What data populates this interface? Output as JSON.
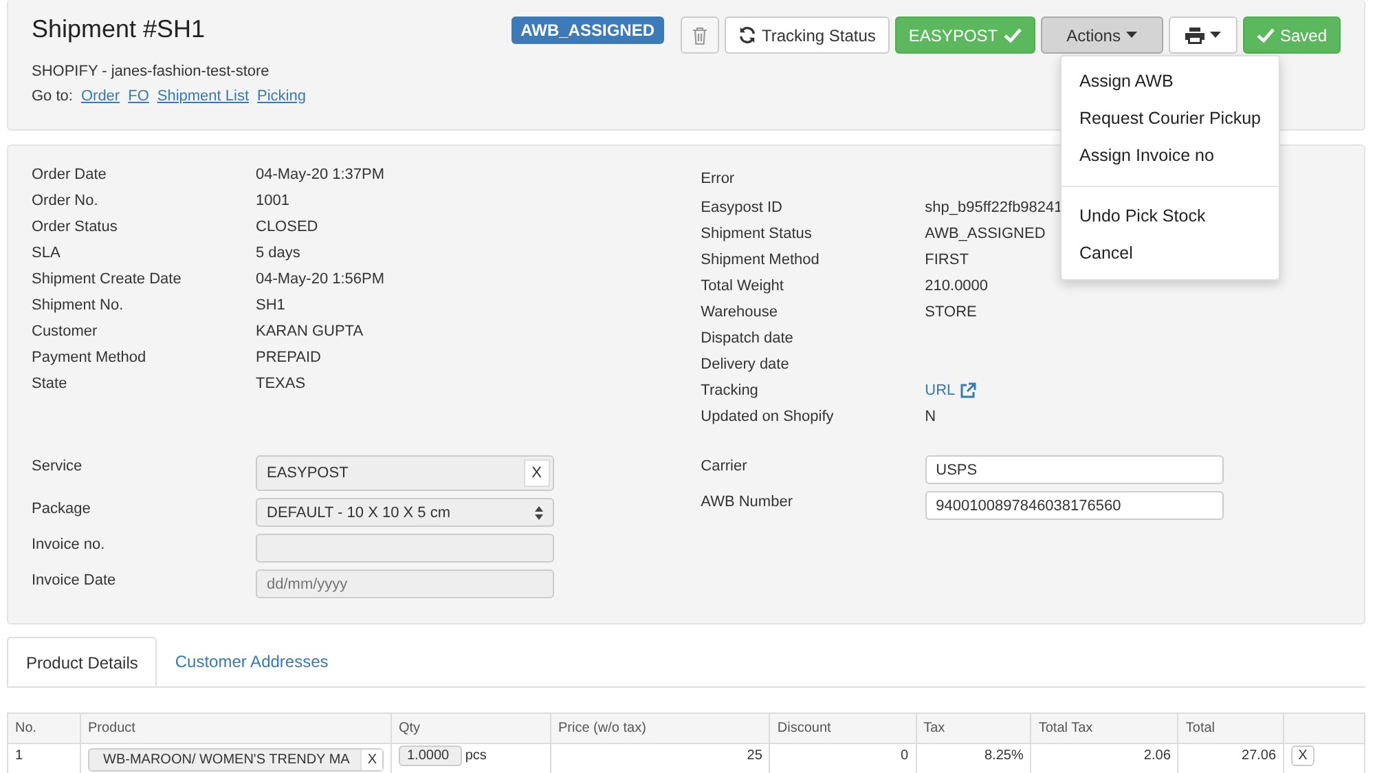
{
  "header": {
    "title": "Shipment #SH1",
    "status_badge": "AWB_ASSIGNED",
    "source": "SHOPIFY - janes-fashion-test-store",
    "goto_label": "Go to:",
    "goto_links": [
      "Order",
      "FO",
      "Shipment List",
      "Picking"
    ]
  },
  "toolbar": {
    "tracking_button": "Tracking Status",
    "courier_button": "EASYPOST",
    "actions_button": {
      "label": "Actions",
      "expanded": true
    },
    "saved_button": "Saved"
  },
  "actions_menu": [
    {
      "kind": "item",
      "label": "Assign AWB"
    },
    {
      "kind": "item",
      "label": "Request Courier Pickup"
    },
    {
      "kind": "item",
      "label": "Assign Invoice no"
    },
    {
      "kind": "divider"
    },
    {
      "kind": "item",
      "label": "Undo Pick Stock"
    },
    {
      "kind": "item",
      "label": "Cancel"
    }
  ],
  "left_details": [
    {
      "label": "Order Date",
      "value": "04-May-20 1:37PM"
    },
    {
      "label": "Order No.",
      "value": "1001"
    },
    {
      "label": "Order Status",
      "value": "CLOSED"
    },
    {
      "label": "SLA",
      "value": "5 days"
    },
    {
      "label": "Shipment Create Date",
      "value": "04-May-20 1:56PM"
    },
    {
      "label": "Shipment No.",
      "value": "SH1"
    },
    {
      "label": "Customer",
      "value": "KARAN GUPTA"
    },
    {
      "label": "Payment Method",
      "value": "PREPAID"
    },
    {
      "label": "State",
      "value": "TEXAS"
    }
  ],
  "error_label": "Error",
  "right_details": [
    {
      "label": "Easypost ID",
      "value": "shp_b95ff22fb98241",
      "kind": "text"
    },
    {
      "label": "Shipment Status",
      "value": "AWB_ASSIGNED",
      "kind": "text"
    },
    {
      "label": "Shipment Method",
      "value": "FIRST",
      "kind": "text"
    },
    {
      "label": "Total Weight",
      "value": "210.0000",
      "kind": "text"
    },
    {
      "label": "Warehouse",
      "value": "STORE",
      "kind": "text"
    },
    {
      "label": "Dispatch date",
      "kind": "text"
    },
    {
      "label": "Delivery date",
      "kind": "text"
    },
    {
      "label": "Tracking",
      "value": "URL",
      "kind": "link"
    },
    {
      "label": "Updated on Shopify",
      "value": "N",
      "kind": "text"
    }
  ],
  "left_fields": [
    {
      "label": "Service",
      "value": "EASYPOST",
      "kind": "clearable",
      "clear": "X"
    },
    {
      "label": "Package",
      "value": "DEFAULT - 10 X 10 X 5 cm",
      "kind": "select"
    },
    {
      "label": "Invoice no.",
      "kind": "input"
    },
    {
      "label": "Invoice Date",
      "placeholder": "dd/mm/yyyy",
      "kind": "input"
    }
  ],
  "right_fields": [
    {
      "label": "Carrier",
      "value": "USPS"
    },
    {
      "label": "AWB Number",
      "value": "9400100897846038176560"
    }
  ],
  "tabs": [
    {
      "label": "Product Details",
      "selected": true
    },
    {
      "label": "Customer Addresses",
      "selected": false
    }
  ],
  "table": {
    "columns": [
      "No.",
      "Product",
      "Qty",
      "Price (w/o tax)",
      "Discount",
      "Tax",
      "Total Tax",
      "Total"
    ],
    "rows": [
      {
        "no": "1",
        "product": "WB-MAROON/ WOMEN'S TRENDY MA",
        "product_clear": "X",
        "qty": "1.0000",
        "unit": "pcs",
        "price": "25",
        "discount": "0",
        "tax": "8.25%",
        "total_tax": "2.06",
        "total": "27.06",
        "remove": "X"
      }
    ]
  }
}
